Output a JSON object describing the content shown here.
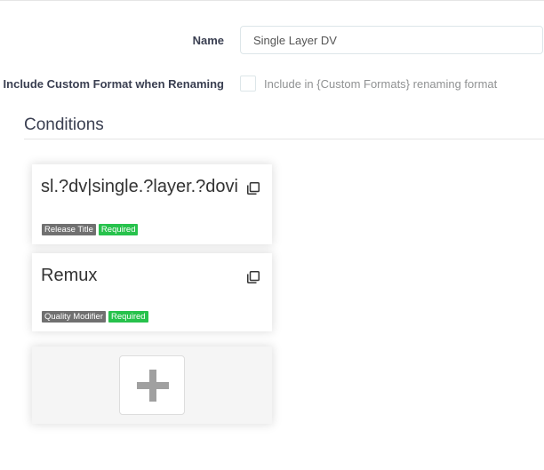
{
  "form": {
    "name_label": "Name",
    "name_value": "Single Layer DV",
    "include_label": "Include Custom Format when Renaming",
    "include_checked": false,
    "include_help": "Include in {Custom Formats} renaming format"
  },
  "conditions": {
    "title": "Conditions",
    "cards": [
      {
        "title": "sl.?dv|single.?layer.?dovi",
        "type_tag": "Release Title",
        "required_tag": "Required"
      },
      {
        "title": "Remux",
        "type_tag": "Quality Modifier",
        "required_tag": "Required"
      }
    ],
    "add_icon": "plus-icon",
    "clone_icon": "clone-icon"
  },
  "colors": {
    "required_tag": "#27c24c",
    "type_tag": "#707070",
    "add_background": "#f5f5f5"
  }
}
